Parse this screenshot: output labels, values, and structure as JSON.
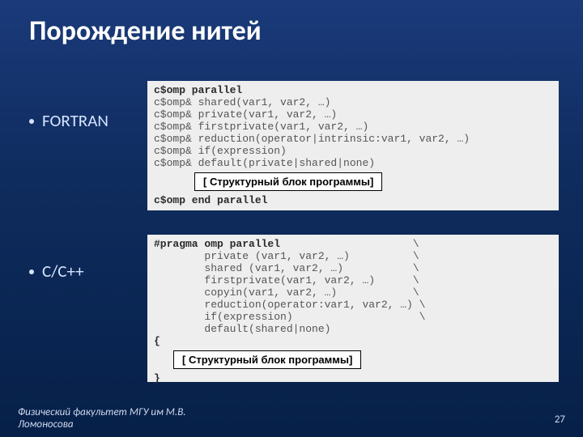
{
  "title": "Порождение нитей",
  "bullets": {
    "fortran": "FORTRAN",
    "cpp": "C/C++"
  },
  "struct_label": "[ Структурный блок программы]",
  "fortran_code": {
    "l1": "c$omp parallel",
    "l2": "c$omp& shared(var1, var2, …)",
    "l3": "c$omp& private(var1, var2, …)",
    "l4": "c$omp& firstprivate(var1, var2, …)",
    "l5": "c$omp& reduction(operator|intrinsic:var1, var2, …)",
    "l6": "c$omp& if(expression)",
    "l7": "c$omp& default(private|shared|none)",
    "l8": "c$omp end parallel"
  },
  "cpp_code": {
    "l1a": "#pragma omp parallel",
    "l1b": "                     \\",
    "l2": "        private (var1, var2, …)          \\",
    "l3": "        shared (var1, var2, …)           \\",
    "l4": "        firstprivate(var1, var2, …)      \\",
    "l5": "        copyin(var1, var2, …)            \\",
    "l6": "        reduction(operator:var1, var2, …) \\",
    "l7": "        if(expression)                    \\",
    "l8": "        default(shared|none)",
    "l9": "{",
    "l10": "}"
  },
  "footer": {
    "left_line1": "Физический факультет МГУ им М.В.",
    "left_line2": "Ломоносова",
    "page": "27"
  }
}
